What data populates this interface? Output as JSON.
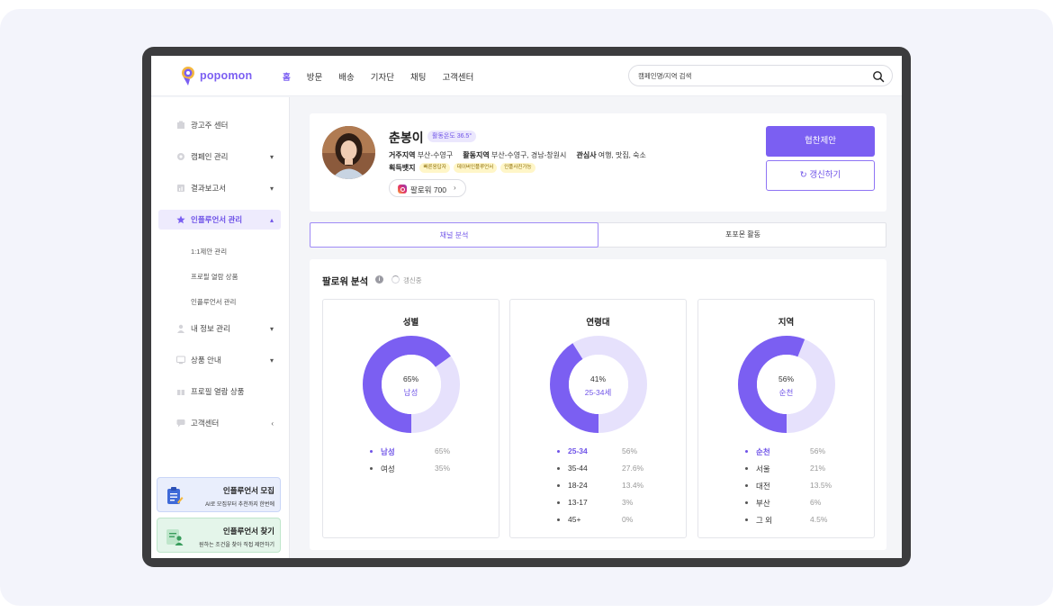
{
  "header": {
    "logo_text": "popomon",
    "nav": [
      "홈",
      "방문",
      "배송",
      "기자단",
      "채팅",
      "고객센터"
    ],
    "search_placeholder": "캠페인명/지역 검색"
  },
  "sidebar": {
    "items": [
      {
        "label": "광고주 센터",
        "icon": "building-icon",
        "chevron": ""
      },
      {
        "label": "캠페인 관리",
        "icon": "gear-icon",
        "chevron": "▾"
      },
      {
        "label": "결과보고서",
        "icon": "report-icon",
        "chevron": "▾"
      },
      {
        "label": "인플루언서 관리",
        "icon": "star-icon",
        "chevron": "▴"
      },
      {
        "label": "내 정보 관리",
        "icon": "person-icon",
        "chevron": "▾"
      },
      {
        "label": "상품 안내",
        "icon": "monitor-icon",
        "chevron": "▾"
      },
      {
        "label": "프로필 열람 상품",
        "icon": "gift-icon",
        "chevron": ""
      },
      {
        "label": "고객센터",
        "icon": "chat-icon",
        "chevron": "‹"
      }
    ],
    "sub_items": [
      "1:1제안 관리",
      "프로필 열람 상품",
      "인플루언서 관리"
    ],
    "promos": [
      {
        "title": "인플루언서 모집",
        "sub": "AI로 모집부터 추천까지 한번에"
      },
      {
        "title": "인플루언서 찾기",
        "sub": "원하는 조건을 찾아 직접 제안하기"
      }
    ]
  },
  "profile": {
    "name": "춘봉이",
    "temperature": "활동온도 36.5°",
    "residence_label": "거주지역",
    "residence": "부산-수영구",
    "activity_label": "활동지역",
    "activity": "부산-수영구, 경남-창원시",
    "interest_label": "관심사",
    "interest": "여행, 맛집, 숙소",
    "badges_label": "획득뱃지",
    "badges": [
      "빠른응답자",
      "데이버인플루언서",
      "인플사진가능"
    ],
    "followers": "팔로워 700",
    "cta_primary": "협찬제안",
    "cta_secondary": "↻ 갱신하기"
  },
  "tabs": {
    "active": "채널 분석",
    "inactive": "포포몬 활동"
  },
  "analysis": {
    "title": "팔로워 분석",
    "status": "갱신중",
    "info_icon": "i"
  },
  "colors": {
    "accent": "#7b5ff2",
    "accent_light": "#e6e1fc"
  },
  "chart_data": [
    {
      "type": "pie",
      "title": "성별",
      "center_value": "65%",
      "center_label": "남성",
      "categories": [
        "남성",
        "여성"
      ],
      "values": [
        65,
        35
      ],
      "value_labels": [
        "65%",
        "35%"
      ]
    },
    {
      "type": "pie",
      "title": "연령대",
      "center_value": "41%",
      "center_label": "25-34세",
      "categories": [
        "25-34",
        "35-44",
        "18-24",
        "13-17",
        "45+"
      ],
      "values": [
        56,
        27.6,
        13.4,
        3,
        0
      ],
      "value_labels": [
        "56%",
        "27.6%",
        "13.4%",
        "3%",
        "0%"
      ]
    },
    {
      "type": "pie",
      "title": "지역",
      "center_value": "56%",
      "center_label": "순천",
      "categories": [
        "순천",
        "서울",
        "대전",
        "부산",
        "그 외"
      ],
      "values": [
        56,
        21,
        13.5,
        6,
        4.5
      ],
      "value_labels": [
        "56%",
        "21%",
        "13.5%",
        "6%",
        "4.5%"
      ]
    }
  ]
}
